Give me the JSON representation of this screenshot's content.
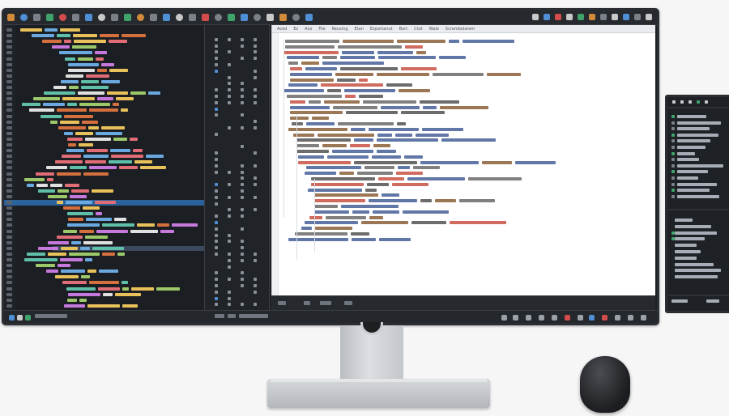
{
  "editor": {
    "tab_labels": [
      "Aced",
      "Ez",
      "Ace",
      "File",
      "Reusing",
      "Etan",
      "Exportanut",
      "Bort",
      "Ctot",
      "Wale",
      "Scrambolarem"
    ]
  },
  "colors": {
    "screen_bg": "#1d2024",
    "editor_bg": "#ffffff",
    "selection": "#2f6fb2",
    "stand": "#c3c6ca",
    "mouse": "#1c1d20"
  },
  "icons": [
    "file-icon",
    "folder-icon",
    "search-icon",
    "git-icon",
    "debug-icon",
    "settings-icon",
    "play-icon",
    "close-icon"
  ]
}
